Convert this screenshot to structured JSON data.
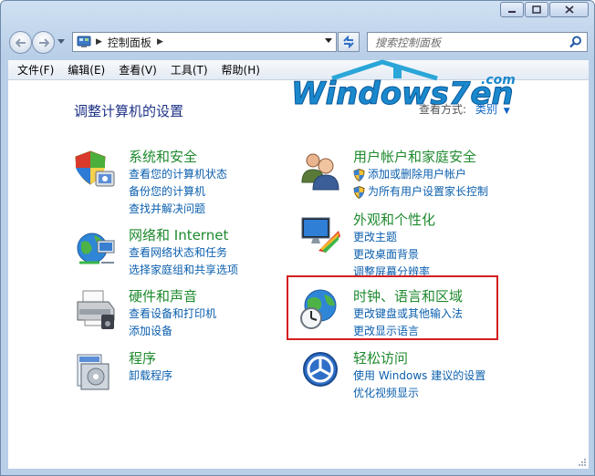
{
  "toolbar": {
    "breadcrumb": "控制面板",
    "search_placeholder": "搜索控制面板"
  },
  "menu": [
    "文件(F)",
    "编辑(E)",
    "查看(V)",
    "工具(T)",
    "帮助(H)"
  ],
  "page": {
    "title": "调整计算机的设置",
    "view_by_label": "查看方式:",
    "view_by_value": "类别"
  },
  "logo": {
    "text": "Windows7en",
    "com": ".com"
  },
  "categories": [
    {
      "title": "系统和安全",
      "icon": "shield-pc-icon",
      "links": [
        "查看您的计算机状态",
        "备份您的计算机",
        "查找并解决问题"
      ]
    },
    {
      "title": "网络和 Internet",
      "icon": "globe-network-icon",
      "links": [
        "查看网络状态和任务",
        "选择家庭组和共享选项"
      ]
    },
    {
      "title": "硬件和声音",
      "icon": "printer-icon",
      "links": [
        "查看设备和打印机",
        "添加设备"
      ]
    },
    {
      "title": "程序",
      "icon": "programs-icon",
      "links": [
        "卸载程序"
      ]
    },
    {
      "title": "用户帐户和家庭安全",
      "icon": "users-icon",
      "links": [
        "添加或删除用户帐户",
        "为所有用户设置家长控制"
      ]
    },
    {
      "title": "外观和个性化",
      "icon": "monitor-paint-icon",
      "links": [
        "更改主题",
        "更改桌面背景",
        "调整屏幕分辨率"
      ]
    },
    {
      "title": "时钟、语言和区域",
      "icon": "globe-clock-icon",
      "links": [
        "更改键盘或其他输入法",
        "更改显示语言"
      ]
    },
    {
      "title": "轻松访问",
      "icon": "ease-of-access-icon",
      "links": [
        "使用 Windows 建议的设置",
        "优化视频显示"
      ]
    }
  ],
  "colors": {
    "category_title": "#1e8a2e",
    "link": "#0b5fae",
    "highlight": "#d41f1f",
    "page_title": "#1e3287"
  }
}
